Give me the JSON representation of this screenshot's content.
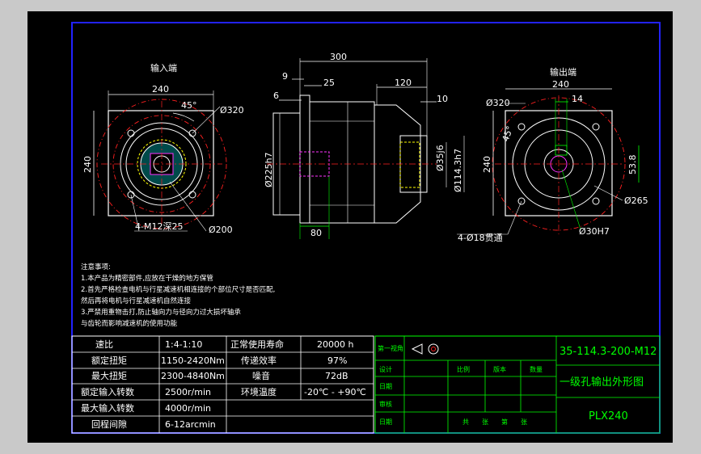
{
  "colors": {
    "frame_bg": "#000000",
    "outer_bg": "#c9c9c9",
    "border_blue": "#2222ff",
    "outline": "#ffffff",
    "center_line": "#ff2020",
    "hidden_line": "#ffff00",
    "magenta": "#ff33ff",
    "title_green": "#00ff00",
    "hatch_cyan": "#00ffff"
  },
  "views": {
    "input_label": "输入端",
    "output_label": "输出端"
  },
  "dims": {
    "in_width": "240",
    "in_angle": "45°",
    "in_pcd": "Ø320",
    "in_height": "240",
    "in_tap": "4-M12深25",
    "in_bore": "Ø200",
    "sv_total": "300",
    "sv_a": "9",
    "sv_b": "25",
    "sv_c": "6",
    "sv_d": "120",
    "sv_e": "10",
    "sv_f": "Ø225h7",
    "sv_g": "Ø35j6",
    "sv_h": "Ø114.3h7",
    "sv_i": "80",
    "out_pcd": "Ø320",
    "out_width": "240",
    "out_key": "14",
    "out_angle": "45°",
    "out_height": "240",
    "out_shaft": "53.8",
    "out_flange": "Ø265",
    "out_holes": "4-Ø18贯通",
    "out_pilot": "Ø30H7"
  },
  "notes": {
    "title": "注意事项:",
    "line1": "1.本产品为精密部件,应放在干燥的地方保管",
    "line2": "2.首先严格检查电机与行星减速机相连接的个部位尺寸是否匹配,",
    "line3": "然后再将电机与行星减速机自然连接",
    "line4": "3.严禁用重物击打,防止轴向力与径向力过大损坏轴承",
    "line5": "与齿轮而影响减速机的使用功能"
  },
  "spec_table": {
    "rows": [
      {
        "k1": "速比",
        "v1": "1:4-1:10",
        "k2": "正常使用寿命",
        "v2": "20000 h"
      },
      {
        "k1": "额定扭矩",
        "v1": "1150-2420Nm",
        "k2": "传递效率",
        "v2": "97%"
      },
      {
        "k1": "最大扭矩",
        "v1": "2300-4840Nm",
        "k2": "噪音",
        "v2": "72dB"
      },
      {
        "k1": "额定输入转数",
        "v1": "2500r/min",
        "k2": "环境温度",
        "v2": "-20℃ - +90℃"
      },
      {
        "k1": "最大输入转数",
        "v1": "4000r/min",
        "k2": "",
        "v2": ""
      },
      {
        "k1": "回程间隙",
        "v1": "6-12arcmin",
        "k2": "",
        "v2": ""
      }
    ]
  },
  "title_block": {
    "projection": "第一视角",
    "design": "设计",
    "date1": "日期",
    "review": "审核",
    "date2": "日期",
    "scale": "比例",
    "version": "版本",
    "quantity": "数量",
    "sheets": "共　　张　　第　　张",
    "drawing_no": "35-114.3-200-M12",
    "drawing_title": "一级孔输出外形图",
    "model": "PLX240"
  }
}
